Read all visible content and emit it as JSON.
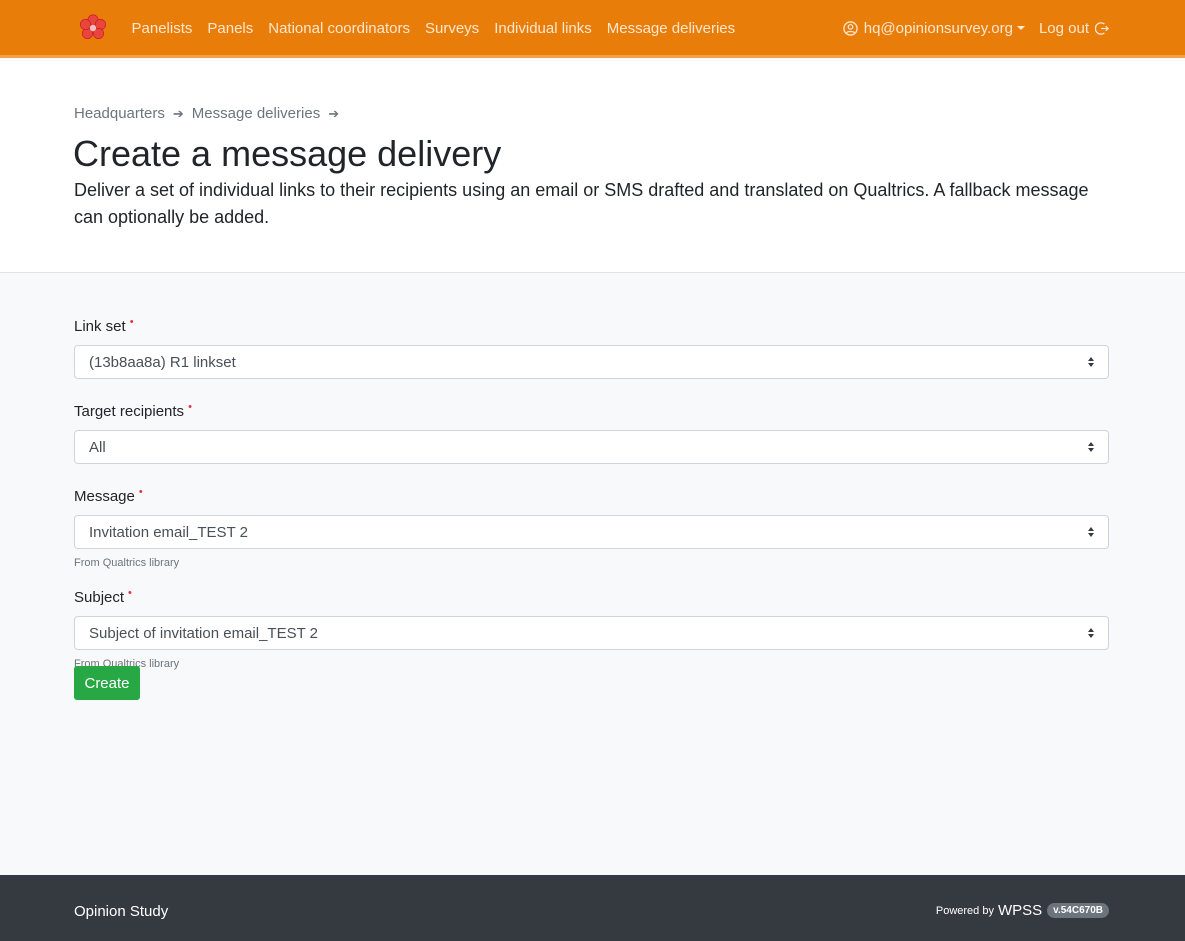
{
  "colors": {
    "navbar": "#e97d0a",
    "accent_button": "#28a745",
    "required": "#dc3545",
    "footer": "#343a40"
  },
  "navbar": {
    "logo_icon": "flower-logo-icon",
    "links": [
      "Panelists",
      "Panels",
      "National coordinators",
      "Surveys",
      "Individual links",
      "Message deliveries"
    ],
    "user": {
      "icon": "user-circle-icon",
      "email": "hq@opinionsurvey.org"
    },
    "logout": {
      "label": "Log out",
      "icon": "logout-icon"
    }
  },
  "breadcrumb": [
    "Headquarters",
    "Message deliveries"
  ],
  "breadcrumb_separator": "➔",
  "page": {
    "title": "Create a message delivery",
    "lead": "Deliver a set of individual links to their recipients using an email or SMS drafted and translated on Qualtrics. A fallback message can optionally be added."
  },
  "form": {
    "required_marker": "•",
    "fields": [
      {
        "label": "Link set",
        "value": "(13b8aa8a) R1 linkset",
        "help": ""
      },
      {
        "label": "Target recipients",
        "value": "All",
        "help": ""
      },
      {
        "label": "Message",
        "value": "Invitation email_TEST 2",
        "help": "From Qualtrics library"
      },
      {
        "label": "Subject",
        "value": "Subject of invitation email_TEST 2",
        "help": "From Qualtrics library"
      }
    ],
    "submit_label": "Create"
  },
  "footer": {
    "brand": "Opinion Study",
    "powered_by": "Powered by",
    "product": "WPSS",
    "version": "v.54C670B"
  }
}
